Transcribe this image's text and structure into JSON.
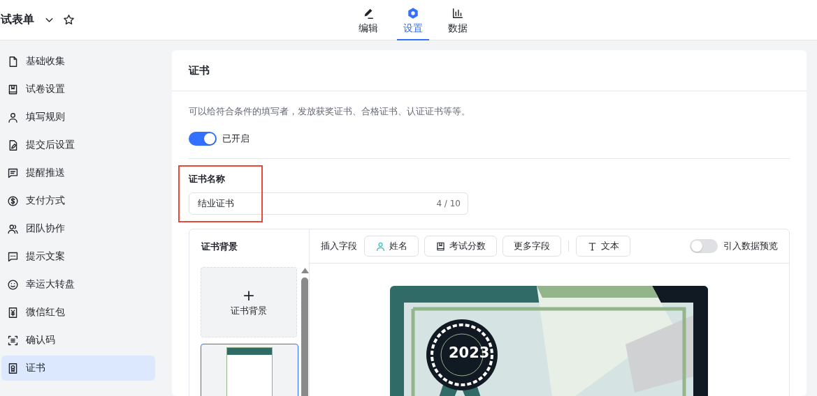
{
  "header": {
    "title": "试表单",
    "starred": false,
    "tabs": [
      {
        "label": "编辑",
        "selected": false
      },
      {
        "label": "设置",
        "selected": true
      },
      {
        "label": "数据",
        "selected": false
      }
    ]
  },
  "sidebar": {
    "items": [
      {
        "label": "基础收集",
        "selected": false
      },
      {
        "label": "试卷设置",
        "selected": false
      },
      {
        "label": "填写规则",
        "selected": false
      },
      {
        "label": "提交后设置",
        "selected": false
      },
      {
        "label": "提醒推送",
        "selected": false
      },
      {
        "label": "支付方式",
        "selected": false
      },
      {
        "label": "团队协作",
        "selected": false
      },
      {
        "label": "提示文案",
        "selected": false
      },
      {
        "label": "幸运大转盘",
        "selected": false
      },
      {
        "label": "微信红包",
        "selected": false
      },
      {
        "label": "确认码",
        "selected": false
      },
      {
        "label": "证书",
        "selected": true
      }
    ]
  },
  "panel": {
    "title": "证书",
    "description": "可以给符合条件的填写者，发放获奖证书、合格证书、认证证书等等。",
    "toggle": {
      "label": "已开启",
      "on": true
    },
    "name_field": {
      "label": "证书名称",
      "value": "结业证书",
      "counter": "4 / 10",
      "highlighted": true
    },
    "editor": {
      "background_title": "证书背景",
      "upload_label": "证书背景",
      "upload_icon": "+",
      "insert_label": "插入字段",
      "fields": [
        {
          "label": "姓名"
        },
        {
          "label": "考试分数"
        },
        {
          "label": "更多字段"
        },
        {
          "label": "文本"
        }
      ],
      "preview_toggle": {
        "label": "引入数据预览",
        "on": false
      },
      "certificate_year": "2023"
    }
  }
}
